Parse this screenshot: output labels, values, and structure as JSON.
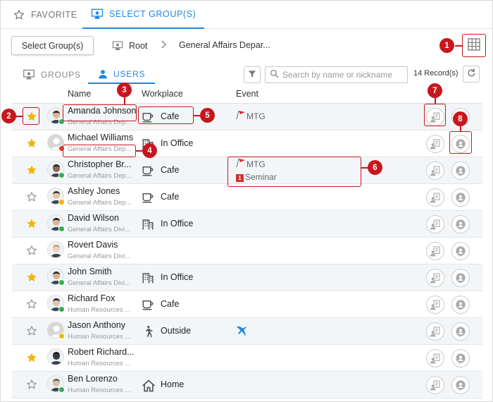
{
  "top_tabs": {
    "favorite": "FAVORITE",
    "select_groups": "SELECT GROUP(S)"
  },
  "toolbar": {
    "select_groups_button": "Select Group(s)",
    "breadcrumb_root": "Root",
    "breadcrumb_current": "General Affairs Depar..."
  },
  "sub_tabs": {
    "groups": "GROUPS",
    "users": "USERS"
  },
  "search": {
    "placeholder": "Search by name or nickname"
  },
  "records": "14 Record(s)",
  "columns": {
    "name": "Name",
    "workplace": "Workplace",
    "event": "Event"
  },
  "colors": {
    "accent": "#1e88e5",
    "star": "#f5b400",
    "online": "#2eaf4f",
    "busy": "#e53935",
    "away": "#f5b400",
    "annotation": "#c8161d"
  },
  "rows": [
    {
      "name": "Amanda Johnson",
      "dept": "General Affairs Dep...",
      "favorite": true,
      "status": "online",
      "workplace": "Cafe",
      "workplace_icon": "coffee-cup-icon",
      "events": [
        "MTG"
      ]
    },
    {
      "name": "Michael Williams",
      "dept": "General Affairs Dep...",
      "favorite": true,
      "status": "busy",
      "workplace": "In Office",
      "workplace_icon": "office-building-icon",
      "events": []
    },
    {
      "name": "Christopher Br...",
      "dept": "General Affairs Dep...",
      "favorite": true,
      "status": "online",
      "workplace": "Cafe",
      "workplace_icon": "coffee-cup-icon",
      "events": [
        "MTG",
        "Seminar"
      ]
    },
    {
      "name": "Ashley Jones",
      "dept": "General Affairs Dep...",
      "favorite": false,
      "status": "away",
      "workplace": "Cafe",
      "workplace_icon": "coffee-cup-icon",
      "events": []
    },
    {
      "name": "David Wilson",
      "dept": "General Affairs Divi...",
      "favorite": true,
      "status": "online",
      "workplace": "In Office",
      "workplace_icon": "office-building-icon",
      "events": []
    },
    {
      "name": "Rovert Davis",
      "dept": "General Affairs Divi...",
      "favorite": false,
      "status": "none",
      "workplace": "",
      "workplace_icon": "",
      "events": []
    },
    {
      "name": "John Smith",
      "dept": "General Affairs Divi...",
      "favorite": true,
      "status": "online",
      "workplace": "In Office",
      "workplace_icon": "office-building-icon",
      "events": []
    },
    {
      "name": "Richard Fox",
      "dept": "Human Resources ...",
      "favorite": false,
      "status": "online",
      "workplace": "Cafe",
      "workplace_icon": "coffee-cup-icon",
      "events": []
    },
    {
      "name": "Jason Anthony",
      "dept": "Human Resources ...",
      "favorite": false,
      "status": "away",
      "workplace": "Outside",
      "workplace_icon": "walking-person-icon",
      "events": [
        "airplane"
      ]
    },
    {
      "name": "Robert Richard...",
      "dept": "Human Resources ...",
      "favorite": true,
      "status": "none",
      "workplace": "",
      "workplace_icon": "",
      "events": []
    },
    {
      "name": "Ben Lorenzo",
      "dept": "Human Resources ...",
      "favorite": false,
      "status": "online",
      "workplace": "Home",
      "workplace_icon": "home-icon",
      "events": []
    }
  ],
  "annotations": [
    "1",
    "2",
    "3",
    "4",
    "5",
    "6",
    "7",
    "8"
  ]
}
